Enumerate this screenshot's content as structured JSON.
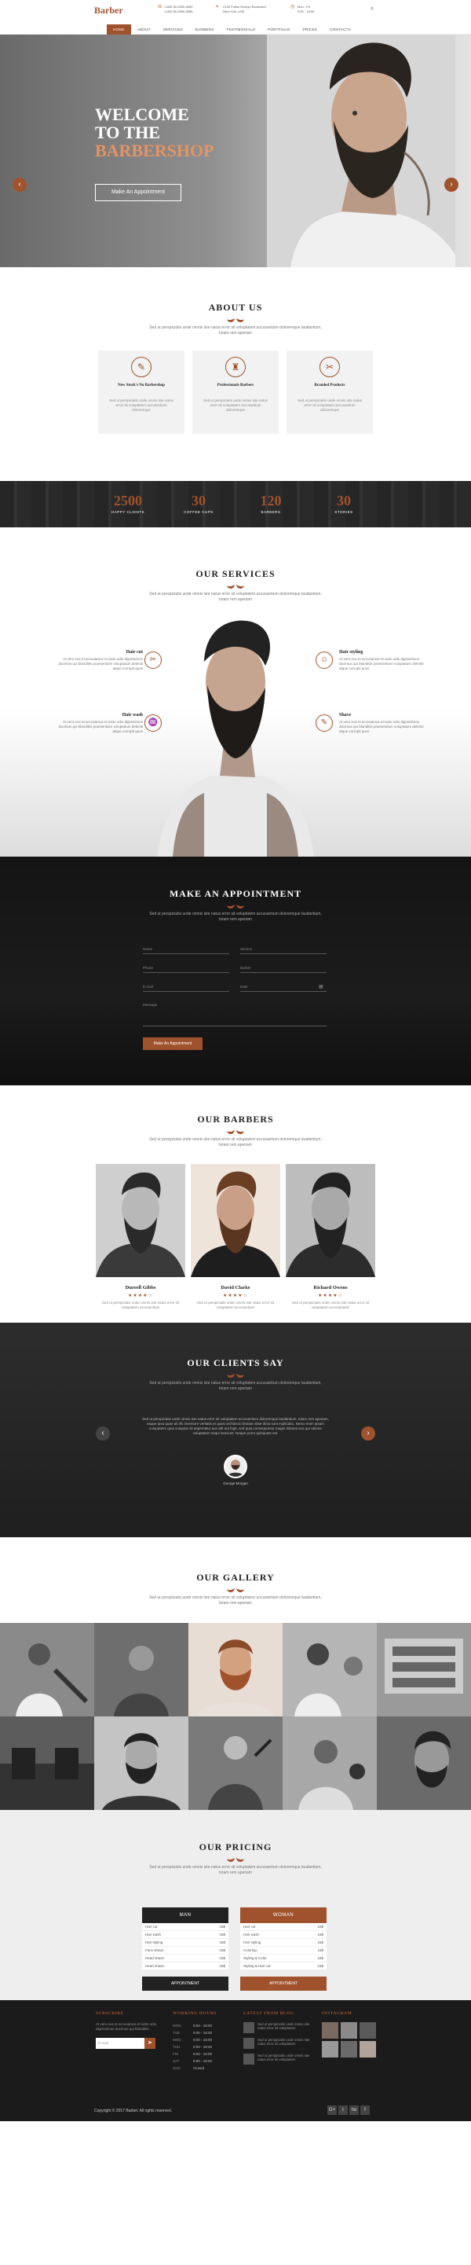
{
  "header": {
    "logo": "Barber",
    "phone_lines": [
      "1-800-50-0000-5555",
      "1-800-50-0000-5555"
    ],
    "address_lines": [
      "2130 Fulton Rockyn Boulevard",
      "New York, USA"
    ],
    "hours_lines": [
      "Mon - Fri",
      "9:00 - 18:00"
    ],
    "nav": [
      "HOME",
      "ABOUT",
      "SERVICES",
      "BARBERS",
      "TESTIMONIALS",
      "PORTFOLIO",
      "PRICES",
      "CONTACTS"
    ]
  },
  "hero": {
    "title_line1": "WELCOME",
    "title_line2": "TO THE",
    "title_line3": "BARBERSHOP",
    "button": "Make An Appointment"
  },
  "about": {
    "title": "ABOUT US",
    "subtitle": "Sed ut perspiciatis unde omnis iste natus error sit voluptatem accusantium doloremque laudantium, totam rem aperiam",
    "cards": [
      {
        "title": "New Stock's No Barbershop",
        "text": "Sed ut perspiciatis unde omnis iste natus error sit voluptatem accusantium doloremque"
      },
      {
        "title": "Professionals Barbers",
        "text": "Sed ut perspiciatis unde omnis iste natus error sit voluptatem accusantium doloremque"
      },
      {
        "title": "Branded Products",
        "text": "Sed ut perspiciatis unde omnis iste natus error sit voluptatem accusantium doloremque"
      }
    ]
  },
  "counters": [
    {
      "value": "2500",
      "label": "HAPPY CLIENTS"
    },
    {
      "value": "30",
      "label": "COFFEE CUPS"
    },
    {
      "value": "120",
      "label": "BARBERS"
    },
    {
      "value": "30",
      "label": "STORIES"
    }
  ],
  "services": {
    "title": "OUR SERVICES",
    "subtitle": "Sed ut perspiciatis unde omnis iste natus error sit voluptatem accusantium doloremque laudantium, totam rem aperiam",
    "items": [
      {
        "title": "Hair cut",
        "text": "At vero eos et accusamus et iusto odio dignissimos ducimus qui blanditiis praesentium voluptatum deleniti atque corrupti quos"
      },
      {
        "title": "Hair styling",
        "text": "At vero eos et accusamus et iusto odio dignissimos ducimus qui blanditiis praesentium voluptatum deleniti atque corrupti quos"
      },
      {
        "title": "Hair wash",
        "text": "At vero eos et accusamus et iusto odio dignissimos ducimus qui blanditiis praesentium voluptatum deleniti atque corrupti quos"
      },
      {
        "title": "Shave",
        "text": "At vero eos et accusamus et iusto odio dignissimos ducimus qui blanditiis praesentium voluptatum deleniti atque corrupti quos"
      }
    ]
  },
  "appointment": {
    "title": "MAKE AN APPOINTMENT",
    "subtitle": "Sed ut perspiciatis unde omnis iste natus error sit voluptatem accusantium doloremque laudantium, totam rem aperiam",
    "fields": [
      "Name",
      "Service",
      "Phone",
      "Barber",
      "E-mail",
      "Date",
      "Message"
    ],
    "button": "Make An Appointment"
  },
  "barbers": {
    "title": "OUR BARBERS",
    "subtitle": "Sed ut perspiciatis unde omnis iste natus error sit voluptatem accusantium doloremque laudantium, totam rem aperiam",
    "people": [
      {
        "name": "Durrell Gibbs",
        "rating": 4,
        "text": "Sed ut perspiciatis unde omnis iste natus error sit voluptatem accusantium"
      },
      {
        "name": "David Clarke",
        "rating": 4,
        "text": "Sed ut perspiciatis unde omnis iste natus error sit voluptatem accusantium"
      },
      {
        "name": "Richard Owens",
        "rating": 4,
        "text": "Sed ut perspiciatis unde omnis iste natus error sit voluptatem accusantium"
      }
    ]
  },
  "clients": {
    "title": "OUR CLIENTS SAY",
    "subtitle": "Sed ut perspiciatis unde omnis iste natus error sit voluptatem accusantium doloremque laudantium, totam rem aperiam",
    "quote": "Sed ut perspiciatis unde omnis iste natus error sit voluptatem accusantium doloremque laudantium, totam rem aperiam, eaque ipsa quae ab illo inventore veritatis et quasi architecto beatae vitae dicta sunt explicabo. Nemo enim ipsam voluptatem quia voluptas sit aspernatur aut odit aut fugit, sed quia consequuntur magni dolores eos qui ratione voluptatem sequi nesciunt. Neque porro quisquam est.",
    "author": "George Morgan"
  },
  "gallery": {
    "title": "OUR GALLERY",
    "subtitle": "Sed ut perspiciatis unde omnis iste natus error sit voluptatem accusantium doloremque laudantium, totam rem aperiam"
  },
  "pricing": {
    "title": "OUR PRICING",
    "subtitle": "Sed ut perspiciatis unde omnis iste natus error sit voluptatem accusantium doloremque laudantium, totam rem aperiam",
    "tables": [
      {
        "name": "MAN",
        "button": "APPOINTMENT",
        "rows": [
          {
            "label": "Hair cut",
            "price": "15$"
          },
          {
            "label": "Hair wash",
            "price": "15$"
          },
          {
            "label": "Hair styling",
            "price": "15$"
          },
          {
            "label": "Face shave",
            "price": "15$"
          },
          {
            "label": "Head shave",
            "price": "15$"
          },
          {
            "label": "Head shave",
            "price": "15$"
          }
        ]
      },
      {
        "name": "WOMAN",
        "button": "APPOINTMENT",
        "rows": [
          {
            "label": "Hair cut",
            "price": "15$"
          },
          {
            "label": "Hair wash",
            "price": "15$"
          },
          {
            "label": "Hair styling",
            "price": "15$"
          },
          {
            "label": "Coloring",
            "price": "15$"
          },
          {
            "label": "Styling & Color",
            "price": "15$"
          },
          {
            "label": "Styling & Hair cut",
            "price": "15$"
          }
        ]
      }
    ]
  },
  "footer": {
    "subscribe_title": "SUBSCRIBE",
    "subscribe_text": "At vero eos et accusamus et iusto odio dignissimos ducimus qui blanditiis",
    "email_placeholder": "E-mail",
    "hours_title": "WORKING HOURS",
    "hours": [
      {
        "day": "MON",
        "time": "9:00 - 18:00"
      },
      {
        "day": "TUE",
        "time": "9:00 - 18:00"
      },
      {
        "day": "WED",
        "time": "9:00 - 18:00"
      },
      {
        "day": "THU",
        "time": "9:00 - 18:00"
      },
      {
        "day": "FRI",
        "time": "9:00 - 18:00"
      },
      {
        "day": "SAT",
        "time": "9:00 - 18:00"
      },
      {
        "day": "SUN",
        "time": "Closed"
      }
    ],
    "blog_title": "LATEST FROM BLOG",
    "blog": [
      "Sed ut perspiciatis unde omnis iste natus error sit voluptatem",
      "Sed ut perspiciatis unde omnis iste natus error sit voluptatem",
      "Sed ut perspiciatis unde omnis iste natus error sit voluptatem"
    ],
    "instagram_title": "INSTAGRAM",
    "copyright": "Copyright © 2017 Barber. All rights reserved.",
    "social": [
      "G+",
      "t",
      "tw",
      "f"
    ]
  },
  "colors": {
    "accent": "#a0522d",
    "dark": "#1b1b1b",
    "light": "#f2f2f2"
  }
}
